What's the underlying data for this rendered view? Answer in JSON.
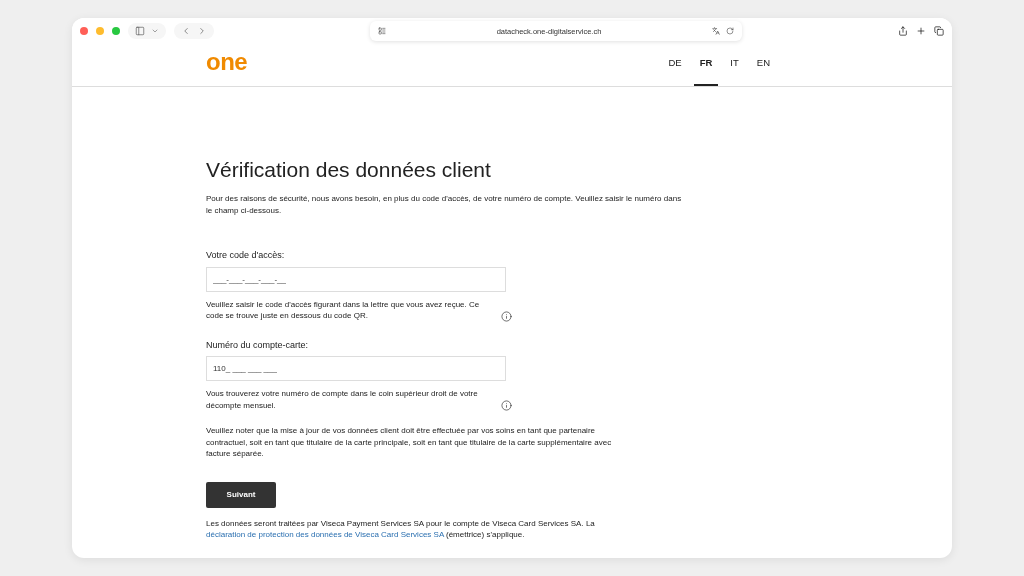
{
  "browser": {
    "url": "datacheck.one-digitalservice.ch"
  },
  "header": {
    "logo": "one",
    "languages": [
      {
        "label": "DE",
        "selected": false
      },
      {
        "label": "FR",
        "selected": true
      },
      {
        "label": "IT",
        "selected": false
      },
      {
        "label": "EN",
        "selected": false
      }
    ]
  },
  "title": "Vérification des données client",
  "intro": "Pour des raisons de sécurité, nous avons besoin, en plus du code d'accès, de votre numéro de compte. Veuillez saisir le numéro dans le champ ci-dessous.",
  "fields": [
    {
      "label": "Votre code d'accès:",
      "placeholder": "___-___-___-___-__",
      "hint": "Veuillez saisir le code d'accès figurant dans la lettre que vous avez reçue. Ce code se trouve juste en dessous du code QR."
    },
    {
      "label": "Numéro du compte-carte:",
      "placeholder": "110_ ___ ___ ___",
      "hint": "Vous trouverez votre numéro de compte dans le coin supérieur droit de votre décompte mensuel."
    }
  ],
  "note": "Veuillez noter que la mise à jour de vos données client doit être effectuée par vos soins en tant que partenaire contractuel, soit en tant que titulaire de la carte principale, soit en tant que titulaire de la carte supplémentaire avec facture séparée.",
  "button": "Suivant",
  "privacy": {
    "before": "Les données seront traitées par Viseca Payment Services SA pour le compte de Viseca Card Services SA. La ",
    "link": "déclaration de protection des données de Viseca Card Services SA",
    "after": " (émettrice) s'applique."
  }
}
